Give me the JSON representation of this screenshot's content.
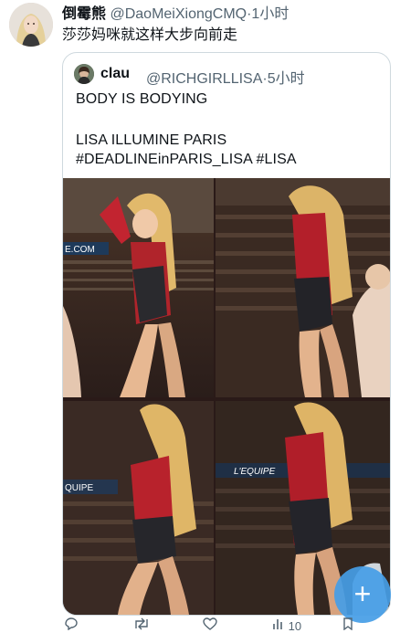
{
  "tweet": {
    "author_name": "倒霉熊",
    "handle": "@DaoMeiXiongCMQ",
    "separator": "·",
    "time": "1小时",
    "text": "莎莎妈咪就这样大步向前走"
  },
  "quoted": {
    "author_name": "clau",
    "handle": "@RICHGIRLLISA",
    "separator": "·",
    "time": "5小时",
    "line1": "BODY IS BODYING",
    "line2": "LISA ILLUMINE PARIS",
    "line3": "#DEADLINEinPARIS_LISA #LISA"
  },
  "media": {
    "photos": [
      "concert-photo-1",
      "concert-photo-2",
      "concert-photo-3",
      "concert-photo-4"
    ],
    "signage": {
      "banner1": "E.COM",
      "banner2": "L'EQUIPE",
      "banner3": "QUIPE"
    }
  },
  "actions": {
    "views": "10"
  },
  "icons": {
    "compose": "compose-plus-icon",
    "reply": "reply-icon",
    "retweet": "retweet-icon",
    "like": "like-icon",
    "views": "views-icon",
    "bookmark": "bookmark-icon"
  },
  "colors": {
    "accent": "#1d9bf0",
    "fab": "#459de6",
    "text_secondary": "#536471",
    "border": "#cfd9de"
  }
}
